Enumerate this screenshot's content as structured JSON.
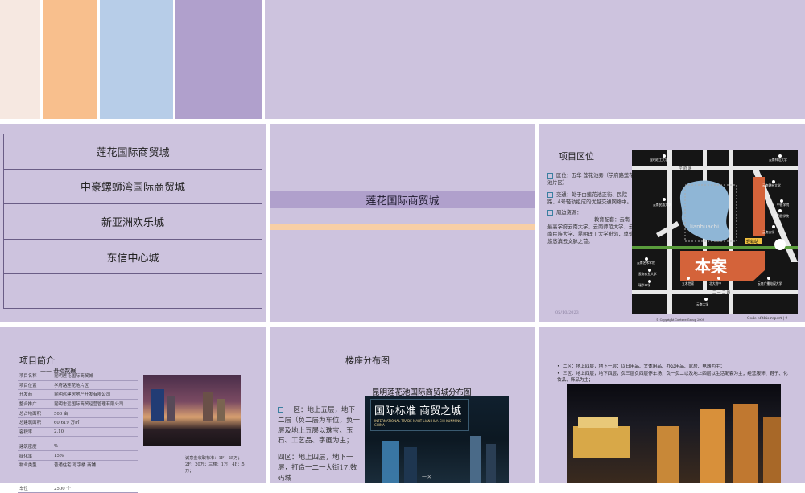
{
  "swatches": [
    "#f6e8e1",
    "#f8bf8d",
    "#b7cde8",
    "#b0a0cc"
  ],
  "slide1": {
    "menu_items": [
      "莲花国际商贸城",
      "中豪螺蛳湾国际商贸城",
      "新亚洲欢乐城",
      "东信中心城",
      ""
    ]
  },
  "slide2": {
    "title": "莲花国际商贸城"
  },
  "slide3": {
    "title": "项目区位",
    "location": "区位：五华 莲花池旁（学府路莲花池片区）",
    "traffic": "交通：处于由莲花池正街、民院路、4号轻轨组成的优越交通网络中。",
    "resources_label": "周边资源：",
    "resources_text": "教育配套：云南最高学府云南大学、云南师范大学、云南民族大学、昆明理工大学毗邻，尊处悠悠滇云文脉之首。",
    "date": "05/10/2023",
    "map_label": "本案",
    "map_subway": "轻轨站",
    "map_schools": [
      "昆明理工大学",
      "云南师范大学",
      "云南财经大学",
      "中医学院",
      "昆明医学院",
      "云南民族大学",
      "云南大学",
      "云南艺术学院",
      "云南农业大学",
      "瑞华中学",
      "五木世家",
      "北大附中",
      "云南大学",
      "云南广播电视大学"
    ],
    "map_road_labels": [
      "二 一 二 路",
      "学 府 路"
    ],
    "footer_left": "© Copyright Coetzee Group 2008",
    "footer_right": "Code of this report | 9"
  },
  "slide4": {
    "title": "项目简介",
    "subtitle": "—— 基础数据",
    "rows": [
      [
        "项目名称",
        "昆明莲花国际商贸城"
      ],
      [
        "项目位置",
        "学府路莲花池片区"
      ],
      [
        "开发商",
        "昆明远建房地产开发有限公司"
      ],
      [
        "整合推广",
        "昆明志远国际商贸经营管理有限公司"
      ],
      [
        "总占地面积",
        "500 亩"
      ],
      [
        "总建筑面积",
        "60.619 万㎡"
      ],
      [
        "容积率",
        "2.10"
      ],
      [
        "建筑密度",
        "%"
      ],
      [
        "绿化率",
        "15%"
      ],
      [
        "物业类型",
        "普通住宅 写字楼 商铺"
      ],
      [
        "车位",
        "2500 个"
      ]
    ],
    "price_note": "诚意金收取标准：1F：25万；2F：20万；三楼：1万；4F：5万；"
  },
  "slide5": {
    "title": "楼座分布图",
    "diagram_title": "昆明莲花池国际商贸城分布图",
    "banner_cn": "国际标准 商贸之城",
    "banner_en": "INTERNATIONAL TRADE MART LIAN HUA CHI KUNMING CHINA",
    "zone1": "一区：地上五层，地下二层（负二层为车位，负一层及地上五层以珠宝、玉石、工艺品、字画为主；",
    "zone4": "四区：地上四层，地下一层，打造一二一大街17.数码城",
    "zone_marker": "一区"
  },
  "slide6": {
    "bullet1": "二区：地上四层，地下一层；以日用品、文体用品、办公用品、家居、电器为主；",
    "bullet2": "三区：地上四层，地下四层，负三层负四层停车场，负一负二以及地上四层以生活配套为主；经营服饰、鞋子、化妆品、饰品为主；"
  }
}
